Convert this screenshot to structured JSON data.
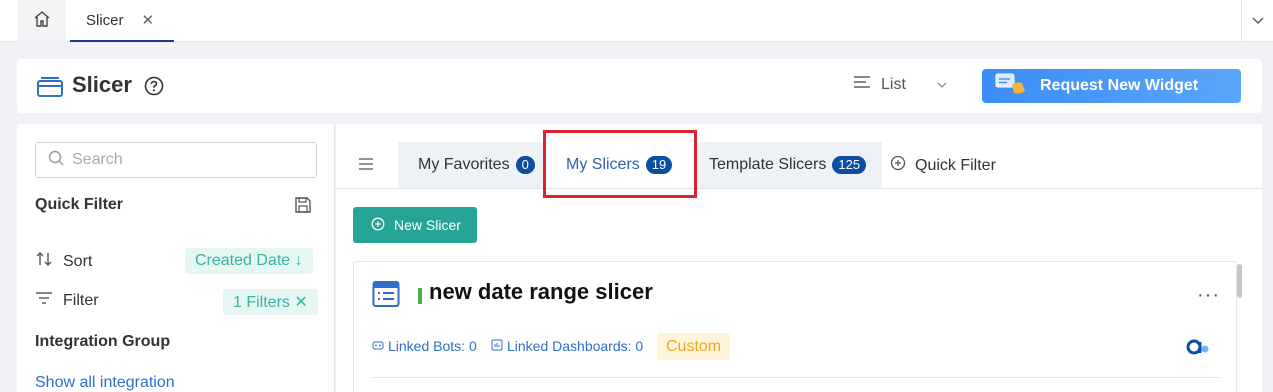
{
  "topbar": {
    "home_icon": "home-icon",
    "tab_label": "Slicer",
    "tab_close": "✕"
  },
  "header": {
    "title": "Slicer",
    "view_mode": "List",
    "request_button": "Request New Widget"
  },
  "sidebar": {
    "search_placeholder": "Search",
    "quick_filter_title": "Quick Filter",
    "sort_label": "Sort",
    "sort_value": "Created Date ↓",
    "filter_label": "Filter",
    "filter_value": "1 Filters ✕",
    "integration_group_title": "Integration Group",
    "show_all_link": "Show all integration"
  },
  "tabs": [
    {
      "label": "My Favorites",
      "count": "0"
    },
    {
      "label": "My Slicers",
      "count": "19"
    },
    {
      "label": "Template Slicers",
      "count": "125"
    }
  ],
  "quick_filter_button": "Quick Filter",
  "new_button": "New Slicer",
  "card": {
    "title": "new date range slicer",
    "linked_bots": "Linked Bots: 0",
    "linked_dashboards": "Linked Dashboards: 0",
    "tag": "Custom",
    "more": "···"
  },
  "colors": {
    "primary": "#26a596",
    "badge": "#0b4ea2",
    "highlight": "#d9232d",
    "link": "#2f6ec9"
  }
}
